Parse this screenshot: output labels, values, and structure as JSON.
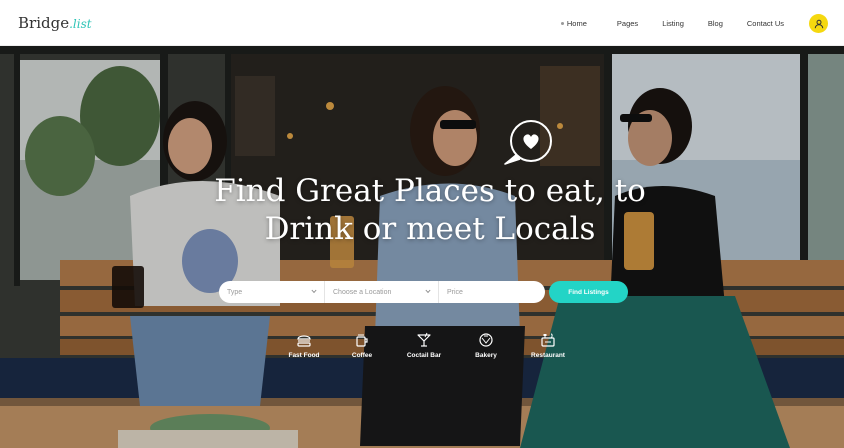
{
  "brand": {
    "name": "Bridge",
    "sub": ".list",
    "accent": "#2ec4b6"
  },
  "nav": {
    "items": [
      {
        "label": "Home"
      },
      {
        "label": "Pages"
      },
      {
        "label": "Listing"
      },
      {
        "label": "Blog"
      },
      {
        "label": "Contact Us"
      }
    ],
    "user_icon": "user-icon",
    "user_color": "#f5d80f"
  },
  "hero": {
    "icon": "heart-chat-bubble-icon",
    "headline_line1": "Find Great Places to eat, to",
    "headline_line2": "Drink or meet Locals"
  },
  "search": {
    "type_placeholder": "Type",
    "location_placeholder": "Choose a Location",
    "price_placeholder": "Price",
    "button_label": "Find Listings",
    "button_color": "#23d4c6"
  },
  "categories": [
    {
      "label": "Fast Food",
      "icon": "burger-icon"
    },
    {
      "label": "Coffee",
      "icon": "coffee-icon"
    },
    {
      "label": "Coctail Bar",
      "icon": "cocktail-icon"
    },
    {
      "label": "Bakery",
      "icon": "cake-icon"
    },
    {
      "label": "Restaurant",
      "icon": "restaurant-icon"
    }
  ]
}
